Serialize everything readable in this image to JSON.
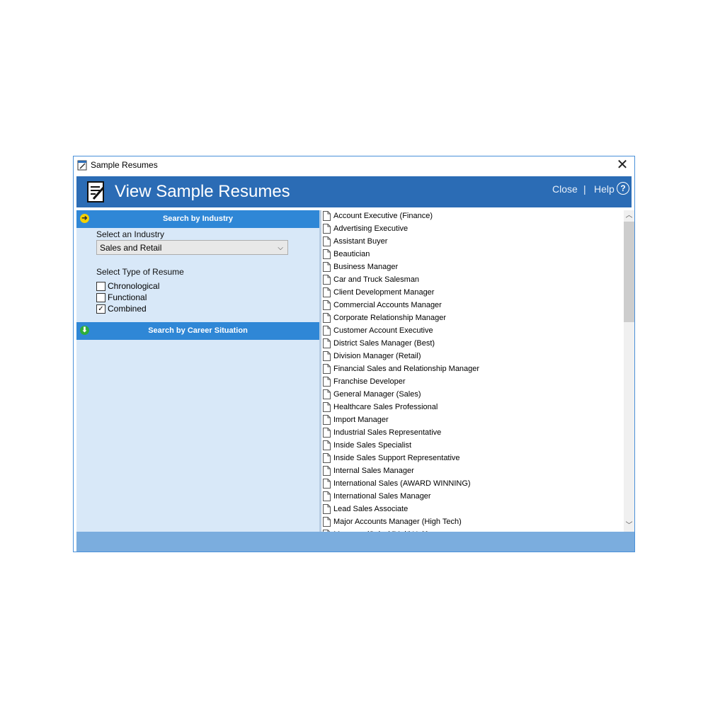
{
  "window": {
    "title": "Sample Resumes",
    "close_glyph": "✕"
  },
  "banner": {
    "heading": "View Sample Resumes",
    "close_label": "Close",
    "separator": "|",
    "help_label": "Help",
    "help_glyph": "?"
  },
  "industry_section": {
    "header": "Search by Industry",
    "select_label": "Select an Industry",
    "selected_industry": "Sales and Retail",
    "type_label": "Select Type of Resume",
    "types": [
      {
        "label": "Chronological",
        "checked": false
      },
      {
        "label": "Functional",
        "checked": false
      },
      {
        "label": "Combined",
        "checked": true
      }
    ]
  },
  "career_section": {
    "header": "Search by Career Situation"
  },
  "resumes": [
    "Account Executive (Finance)",
    "Advertising Executive",
    "Assistant Buyer",
    "Beautician",
    "Business Manager",
    "Car and Truck Salesman",
    "Client Development Manager",
    "Commercial Accounts Manager",
    "Corporate Relationship Manager",
    "Customer Account Executive",
    "District Sales Manager (Best)",
    "Division Manager (Retail)",
    "Financial Sales and Relationship Manager",
    "Franchise Developer",
    "General Manager (Sales)",
    "Healthcare Sales Professional",
    "Import Manager",
    "Industrial Sales Representative",
    "Inside Sales Specialist",
    "Inside Sales Support Representative",
    "Internal Sales Manager",
    "International Sales (AWARD WINNING)",
    "International Sales Manager",
    "Lead Sales Associate",
    "Major Accounts Manager (High Tech)",
    "Manager (Sales)(Multi Unit)"
  ],
  "colors": {
    "banner": "#2b6cb5",
    "section_header": "#2f87d6",
    "left_pane": "#d8e8f8",
    "footer": "#7badde"
  }
}
